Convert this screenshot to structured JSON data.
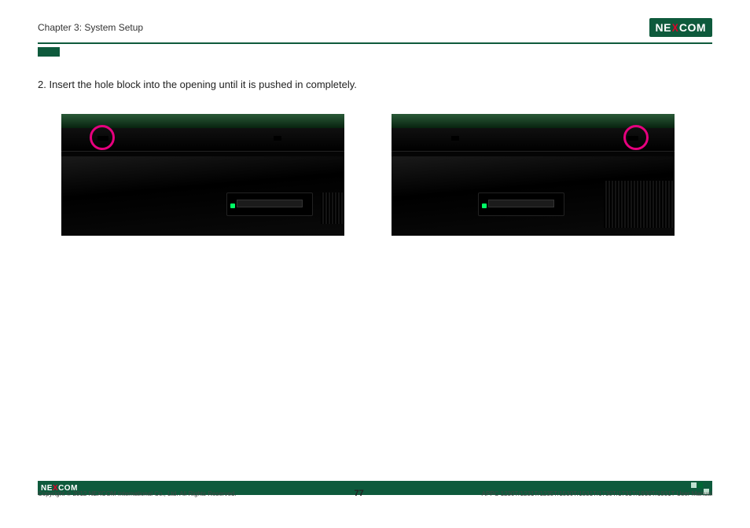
{
  "header": {
    "chapter": "Chapter 3: System Setup",
    "logo_prefix": "NE",
    "logo_x": "X",
    "logo_suffix": "COM"
  },
  "content": {
    "step_number": "2.",
    "step_text": "Insert the hole block into the opening until it is pushed in completely."
  },
  "footer": {
    "logo_prefix": "NE",
    "logo_x": "X",
    "logo_suffix": "COM",
    "copyright": "Copyright © 2012 NEXCOM International Co., Ltd. All Rights Reserved.",
    "page_number": "77",
    "manual": "APPC 1230T/1231T/1235T/1530T/1531T/1730T/1731T/1930T/1931T User Manual"
  }
}
